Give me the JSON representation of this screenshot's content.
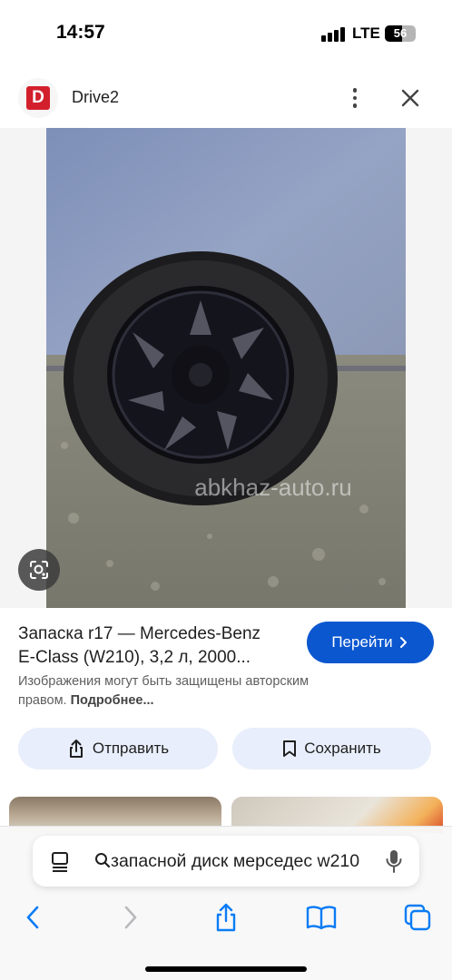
{
  "status_bar": {
    "time": "14:57",
    "network": "LTE",
    "battery": "56",
    "battery_level": 0.56
  },
  "header": {
    "logo_letter": "D",
    "app_name": "Drive2",
    "brand_color": "#d31f2c"
  },
  "image": {
    "watermark": "abkhaz-auto.ru"
  },
  "result": {
    "title_line1": "Запаска r17 — Mercedes-Benz",
    "title_line2": "E-Class (W210), 3,2 л, 2000...",
    "goto_label": "Перейти",
    "copyright_text": "Изображения могут быть защищены авторским правом.",
    "more_link": "Подробнее...",
    "accent_color": "#0b57d0"
  },
  "actions": {
    "share_label": "Отправить",
    "save_label": "Сохранить"
  },
  "browser": {
    "address_text": "запасной диск мерседес w210",
    "icons": [
      "reader-icon",
      "search-icon",
      "mic-icon",
      "back-icon",
      "forward-icon",
      "share-icon",
      "bookmarks-icon",
      "tabs-icon"
    ]
  }
}
